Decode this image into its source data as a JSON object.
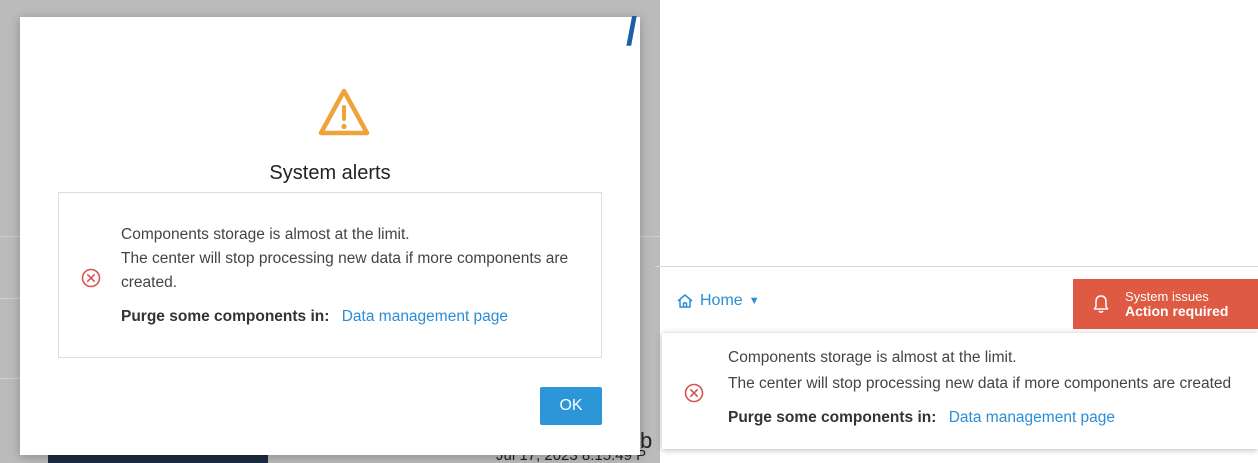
{
  "background": {
    "partial_char": "b",
    "partial_date": "Jul 17, 2023 8:15:49 P"
  },
  "modal": {
    "title": "System alerts",
    "alert": {
      "line1": "Components storage is almost at the limit.",
      "line2": "The center will stop processing new data if more components are",
      "line3": "created.",
      "purge_label": "Purge some components in:",
      "link_text": "Data management page"
    },
    "ok_label": "OK"
  },
  "header": {
    "home_label": "Home",
    "system_issues": {
      "line1": "System issues",
      "line2": "Action required"
    }
  },
  "panel": {
    "line1": "Components storage is almost at the limit.",
    "line2": "The center will stop processing new data if more components are created",
    "purge_label": "Purge some components in:",
    "link_text": "Data management page"
  },
  "colors": {
    "warning": "#f0a23b",
    "error": "#d9534f",
    "link": "#2b8dd6",
    "button": "#2d96d8",
    "system_issues": "#de5a43"
  }
}
